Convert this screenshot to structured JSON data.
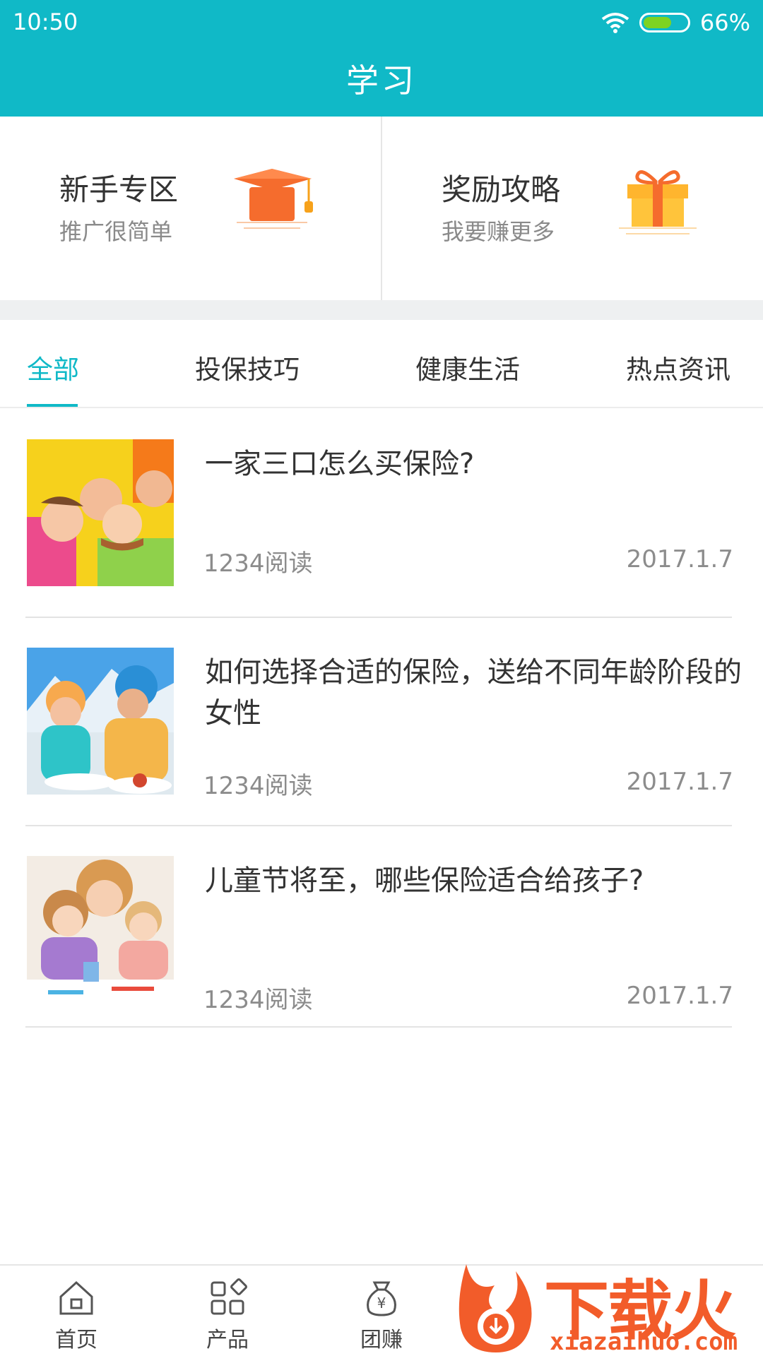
{
  "status_bar": {
    "time": "10:50",
    "battery": "66%"
  },
  "header": {
    "title": "学习"
  },
  "features": [
    {
      "title": "新手专区",
      "subtitle": "推广很简单",
      "icon": "graduation-cap-icon"
    },
    {
      "title": "奖励攻略",
      "subtitle": "我要赚更多",
      "icon": "gift-box-icon"
    }
  ],
  "tabs": [
    {
      "label": "全部",
      "active": true
    },
    {
      "label": "投保技巧",
      "active": false
    },
    {
      "label": "健康生活",
      "active": false
    },
    {
      "label": "热点资讯",
      "active": false
    }
  ],
  "articles": [
    {
      "title": "一家三口怎么买保险?",
      "reads": "1234阅读",
      "date": "2017.1.7",
      "image": "family-photo"
    },
    {
      "title": "如何选择合适的保险，送给不同年龄阶段的女性",
      "reads": "1234阅读",
      "date": "2017.1.7",
      "image": "women-skiing-photo"
    },
    {
      "title": "儿童节将至，哪些保险适合给孩子?",
      "reads": "1234阅读",
      "date": "2017.1.7",
      "image": "children-painting-photo"
    }
  ],
  "bottom_nav": [
    {
      "label": "首页",
      "icon": "home-icon"
    },
    {
      "label": "产品",
      "icon": "grid-icon"
    },
    {
      "label": "团赚",
      "icon": "money-bag-icon"
    }
  ],
  "watermark": {
    "text": "下载火",
    "url": "xiazaihuo.com"
  },
  "colors": {
    "accent": "#10b9c7",
    "orange": "#f56c2d",
    "gift": "#ffc43b"
  }
}
